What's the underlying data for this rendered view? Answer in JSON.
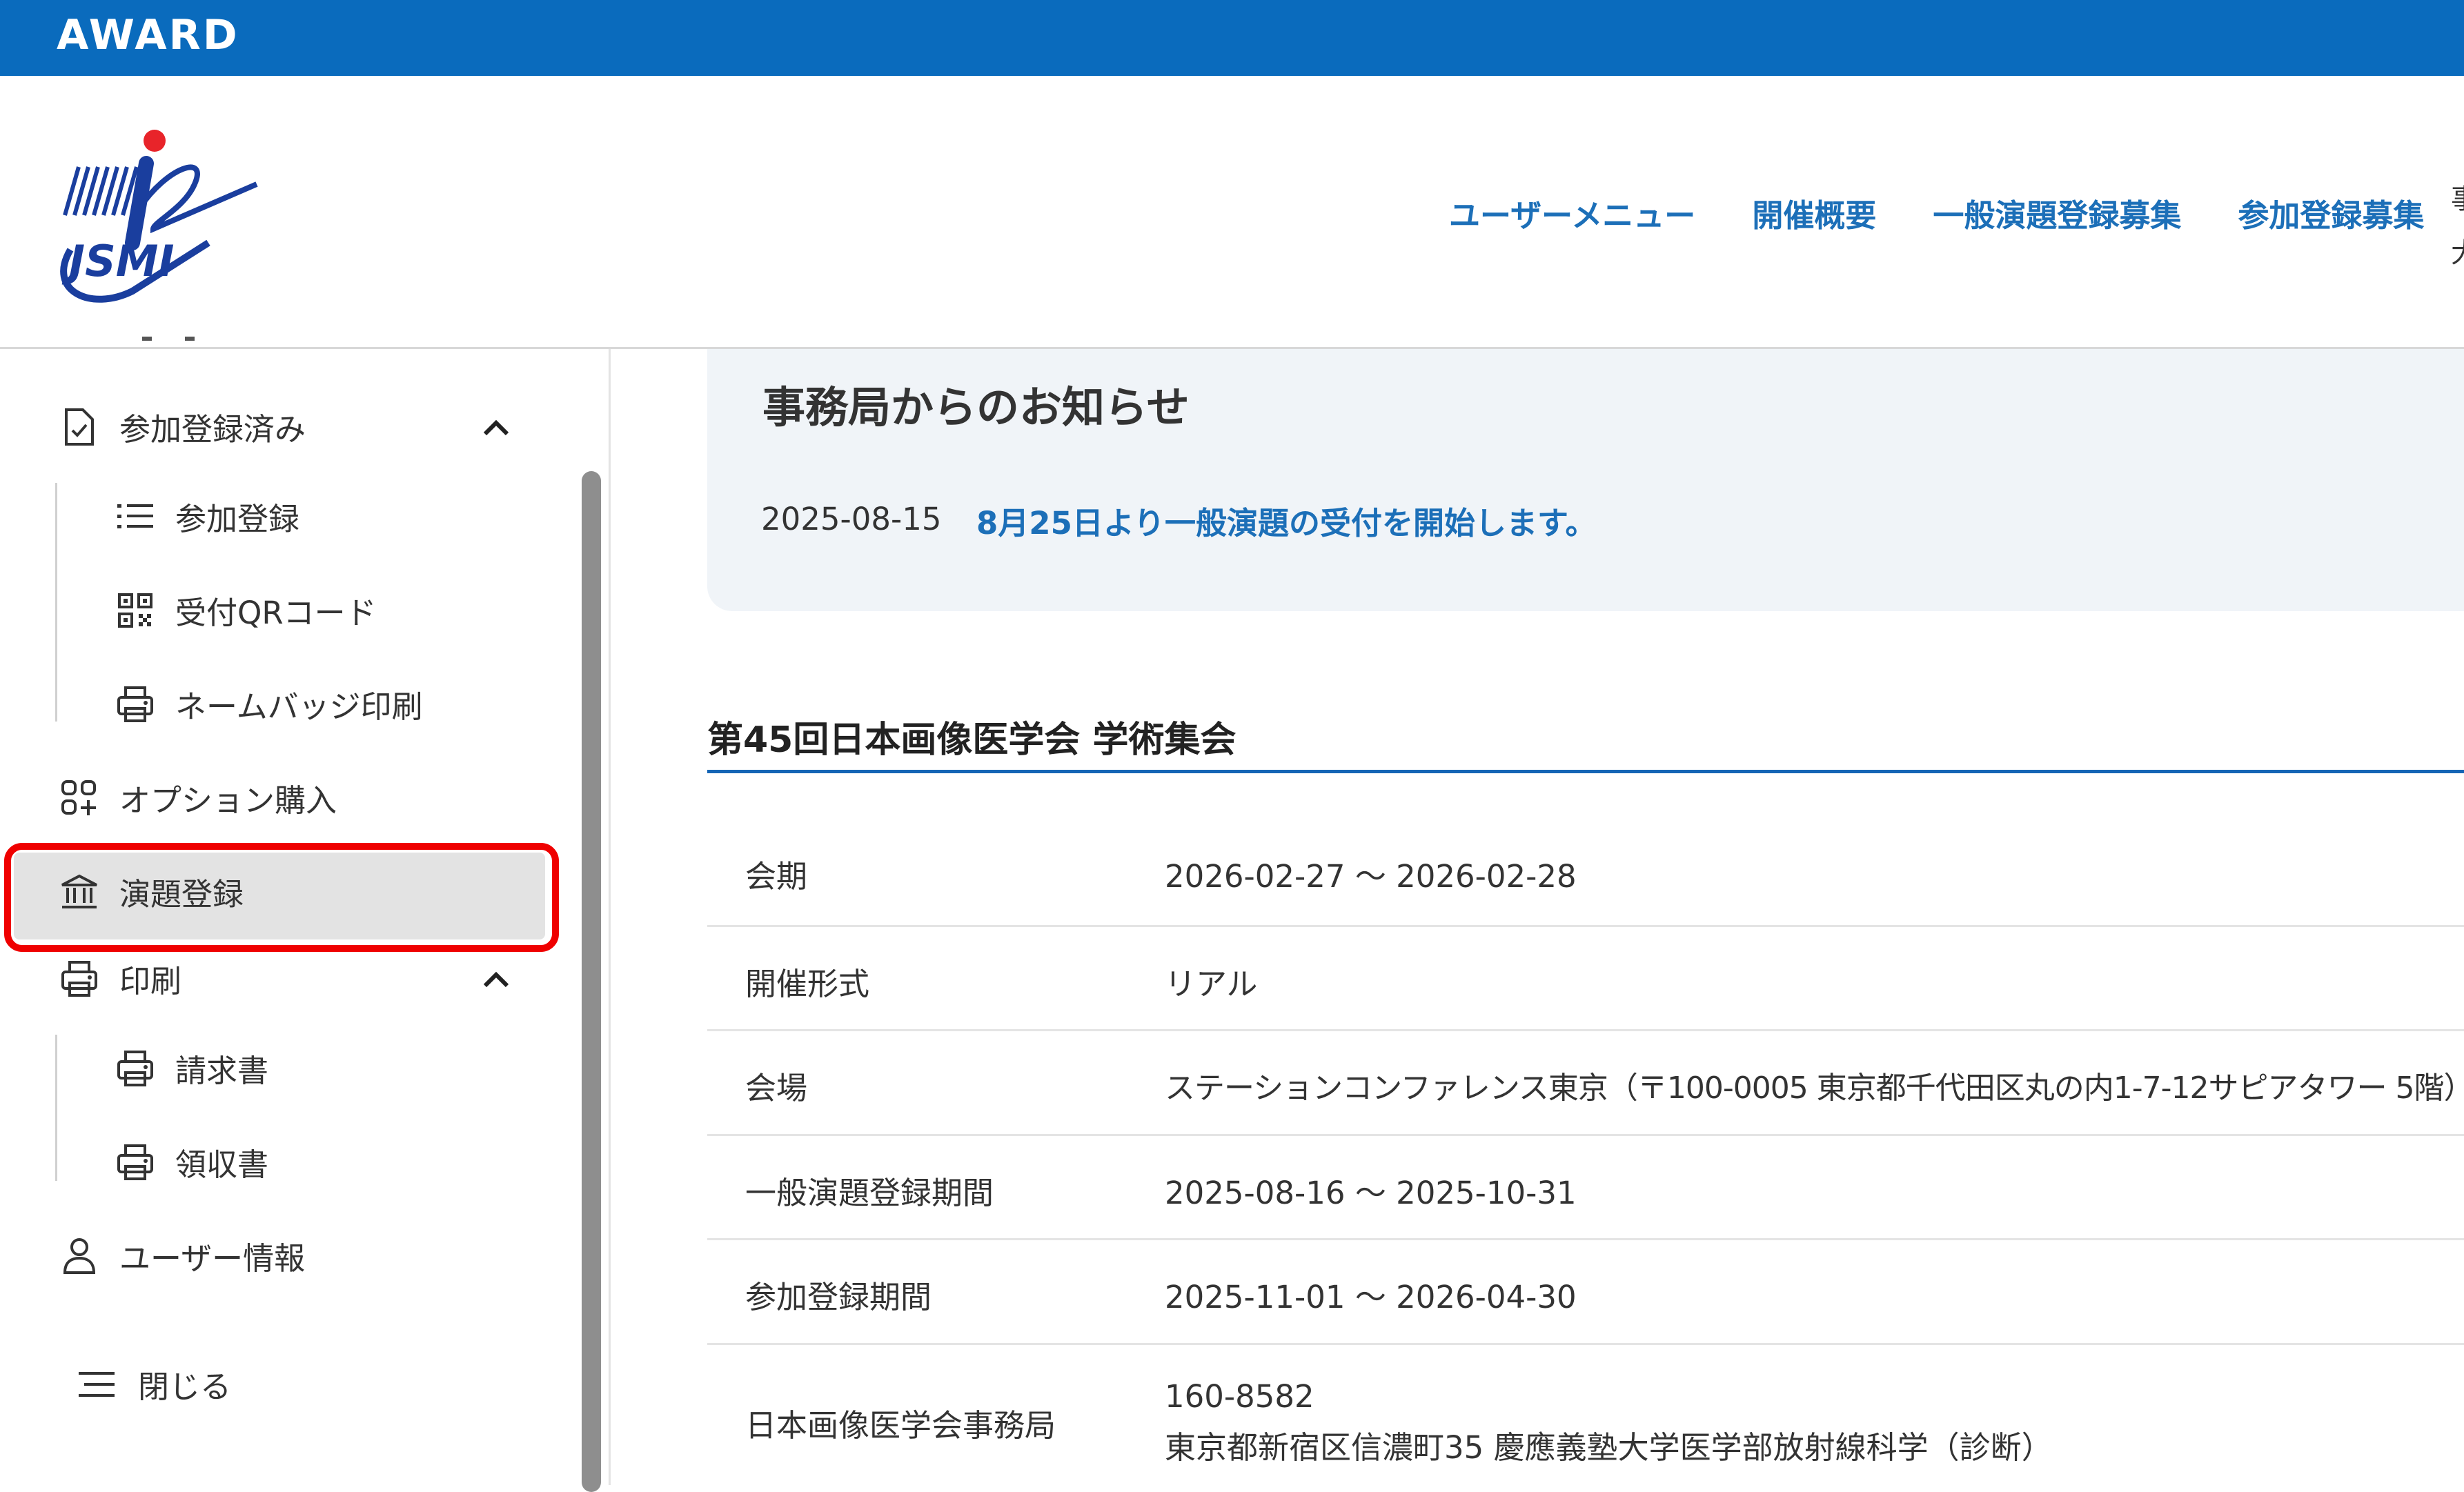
{
  "brand": {
    "name": "AWARD"
  },
  "header": {
    "logo_text": "JSMI",
    "nav": [
      "ユーザーメニュー",
      "開催概要",
      "一般演題登録募集",
      "参加登録募集"
    ],
    "colors": {
      "topbar": "#0a6bbd",
      "nav_text": "#1c6fb8"
    }
  },
  "sidebar": {
    "participation_done": "参加登録済み",
    "registration": "参加登録",
    "qr_code": "受付QRコード",
    "name_badge": "ネームバッジ印刷",
    "option_purchase": "オプション購入",
    "abstract_registration": "演題登録",
    "print": "印刷",
    "invoice": "請求書",
    "receipt": "領収書",
    "user_info": "ユーザー情報",
    "close": "閉じる",
    "icons": [
      "document-check-icon",
      "list-icon",
      "qr-code-icon",
      "printer-icon",
      "apps-plus-icon",
      "bank-icon",
      "user-icon",
      "menu-icon",
      "chevron-up-icon"
    ]
  },
  "notice": {
    "title": "事務局からのお知らせ",
    "date": "2025-08-15",
    "link_text": "8月25日より一般演題の受付を開始します。"
  },
  "event": {
    "title": "第45回日本画像医学会 学術集会",
    "rows": [
      {
        "label": "会期",
        "value": "2026-02-27 〜 2026-02-28"
      },
      {
        "label": "開催形式",
        "value": "リアル"
      },
      {
        "label": "会場",
        "value": "ステーションコンファレンス東京（〒100-0005 東京都千代田区丸の内1-7-12サピアタワー 5階）"
      },
      {
        "label": "一般演題登録期間",
        "value": "2025-08-16 〜 2025-10-31"
      },
      {
        "label": "参加登録期間",
        "value": "2025-11-01 〜 2026-04-30"
      },
      {
        "label": "日本画像医学会事務局",
        "value_line1": "160-8582",
        "value_line2": "東京都新宿区信濃町35 慶應義塾大学医学部放射線科学（診断）"
      }
    ]
  },
  "highlight_color": "#ef0000"
}
